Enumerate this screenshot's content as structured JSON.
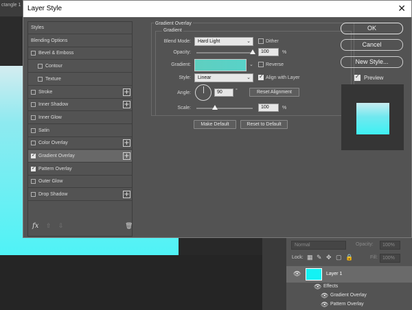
{
  "background": {
    "doc_tab": "ctangle 1",
    "layers_panel": {
      "blend_mode": "Normal",
      "opacity_label": "Opacity:",
      "opacity_value": "100%",
      "lock_label": "Lock:",
      "fill_label": "Fill:",
      "fill_value": "100%",
      "layer_name": "Layer 1",
      "effects_label": "Effects",
      "effects": [
        "Gradient Overlay",
        "Pattern Overlay"
      ]
    }
  },
  "dialog": {
    "title": "Layer Style",
    "styles_list": [
      {
        "label": "Styles",
        "checkbox": false,
        "checked": false,
        "plus": false,
        "indent": 0
      },
      {
        "label": "Blending Options",
        "checkbox": false,
        "checked": false,
        "plus": false,
        "indent": 0
      },
      {
        "label": "Bevel & Emboss",
        "checkbox": true,
        "checked": false,
        "plus": false,
        "indent": 0
      },
      {
        "label": "Contour",
        "checkbox": true,
        "checked": false,
        "plus": false,
        "indent": 1
      },
      {
        "label": "Texture",
        "checkbox": true,
        "checked": false,
        "plus": false,
        "indent": 1
      },
      {
        "label": "Stroke",
        "checkbox": true,
        "checked": false,
        "plus": true,
        "indent": 0
      },
      {
        "label": "Inner Shadow",
        "checkbox": true,
        "checked": false,
        "plus": true,
        "indent": 0
      },
      {
        "label": "Inner Glow",
        "checkbox": true,
        "checked": false,
        "plus": false,
        "indent": 0
      },
      {
        "label": "Satin",
        "checkbox": true,
        "checked": false,
        "plus": false,
        "indent": 0
      },
      {
        "label": "Color Overlay",
        "checkbox": true,
        "checked": false,
        "plus": true,
        "indent": 0
      },
      {
        "label": "Gradient Overlay",
        "checkbox": true,
        "checked": true,
        "plus": true,
        "indent": 0,
        "selected": true
      },
      {
        "label": "Pattern Overlay",
        "checkbox": true,
        "checked": true,
        "plus": false,
        "indent": 0
      },
      {
        "label": "Outer Glow",
        "checkbox": true,
        "checked": false,
        "plus": false,
        "indent": 0
      },
      {
        "label": "Drop Shadow",
        "checkbox": true,
        "checked": false,
        "plus": true,
        "indent": 0
      }
    ],
    "list_footer": {
      "fx": "fx",
      "up": "⇧",
      "down": "⇩",
      "trash": "🗑"
    },
    "gradient_overlay": {
      "section_title": "Gradient Overlay",
      "group_title": "Gradient",
      "blend_mode_label": "Blend Mode:",
      "blend_mode": "Hard Light",
      "dither_label": "Dither",
      "dither": false,
      "opacity_label": "Opacity:",
      "opacity_value": "100",
      "opacity_unit": "%",
      "opacity_fraction": 1.0,
      "gradient_label": "Gradient:",
      "reverse_label": "Reverse",
      "reverse": false,
      "style_label": "Style:",
      "style": "Linear",
      "align_label": "Align with Layer",
      "align": true,
      "angle_label": "Angle:",
      "angle_value": "90",
      "angle_unit": "°",
      "reset_alignment": "Reset Alignment",
      "scale_label": "Scale:",
      "scale_value": "100",
      "scale_unit": "%",
      "scale_fraction": 0.33,
      "make_default": "Make Default",
      "reset_default": "Reset to Default"
    },
    "buttons": {
      "ok": "OK",
      "cancel": "Cancel",
      "new_style": "New Style...",
      "preview_label": "Preview"
    },
    "colors": {
      "gradient_color": "#5fcfc0",
      "layer_color": "#14f2f4"
    }
  }
}
